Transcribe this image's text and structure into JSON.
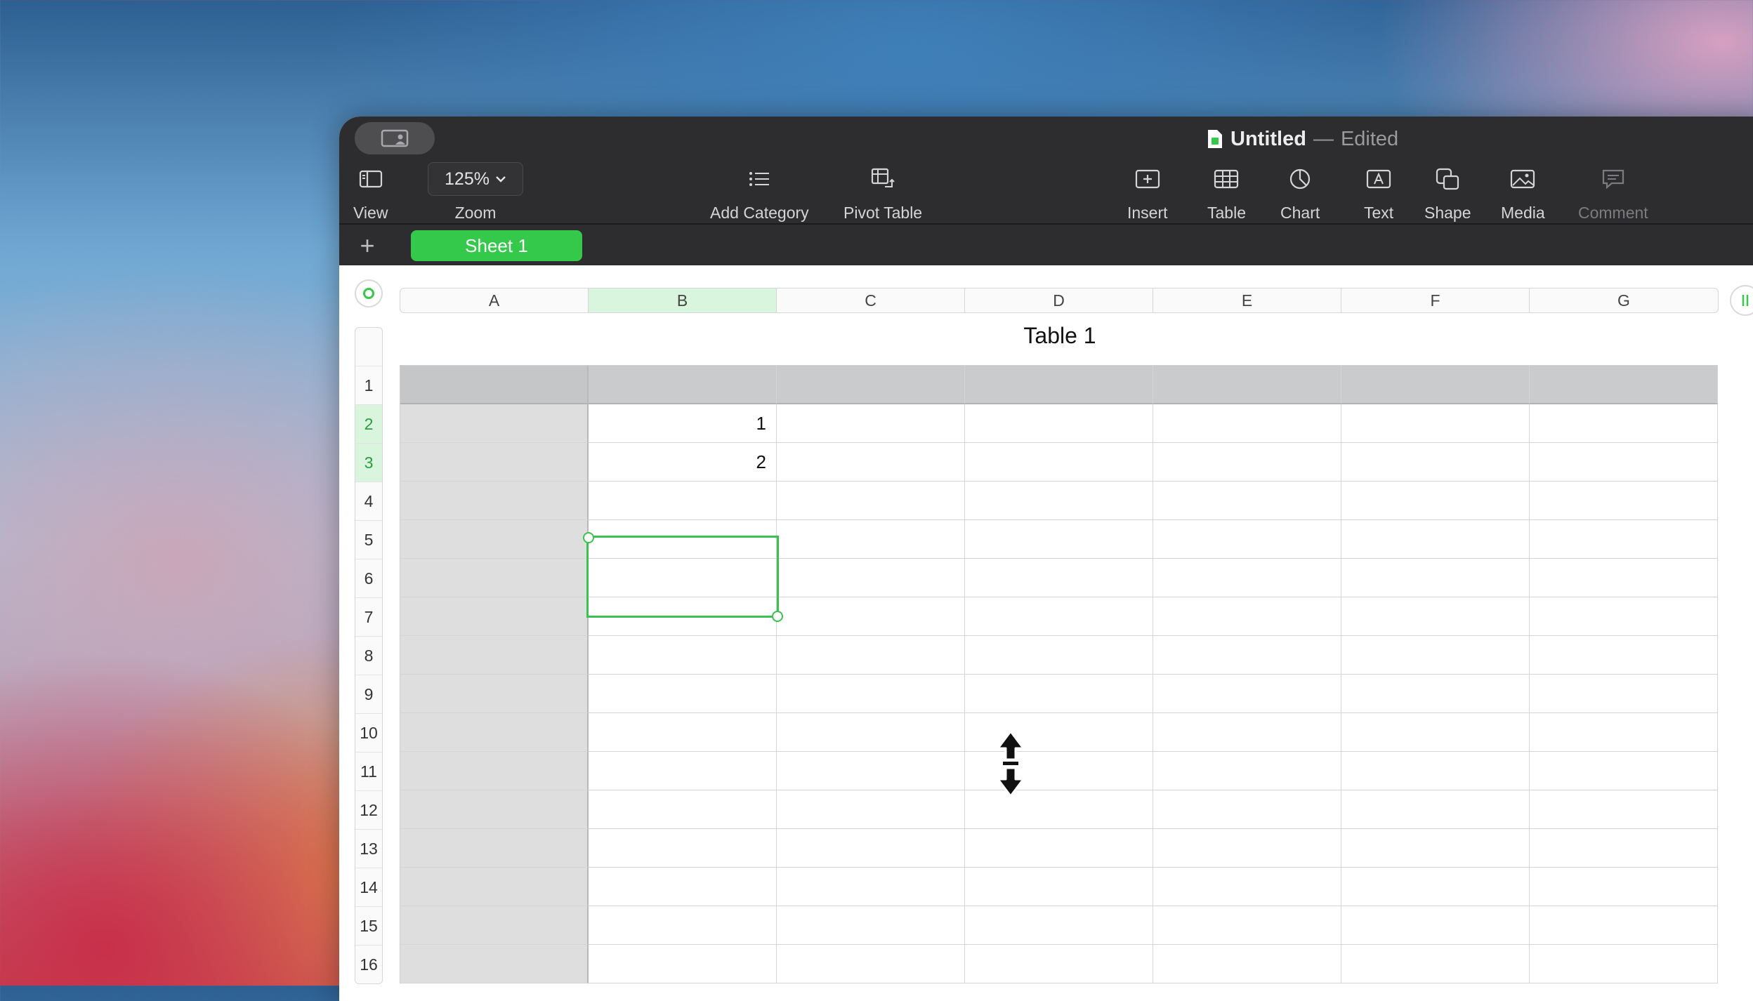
{
  "window": {
    "title": "Untitled",
    "separator": "—",
    "status": "Edited"
  },
  "toolbar": {
    "view": {
      "label": "View",
      "icon": "sidebar-icon"
    },
    "zoom": {
      "label": "Zoom",
      "value": "125%"
    },
    "add_category": {
      "label": "Add Category",
      "icon": "list-icon"
    },
    "pivot_table": {
      "label": "Pivot Table",
      "icon": "pivot-table-icon"
    },
    "insert": {
      "label": "Insert",
      "icon": "insert-icon"
    },
    "table": {
      "label": "Table",
      "icon": "table-icon"
    },
    "chart": {
      "label": "Chart",
      "icon": "chart-icon"
    },
    "text": {
      "label": "Text",
      "icon": "text-box-icon"
    },
    "shape": {
      "label": "Shape",
      "icon": "shape-icon"
    },
    "media": {
      "label": "Media",
      "icon": "media-icon"
    },
    "comment": {
      "label": "Comment",
      "icon": "comment-icon"
    }
  },
  "sheets": {
    "add_symbol": "+",
    "tabs": [
      "Sheet 1"
    ]
  },
  "table": {
    "title": "Table 1",
    "columns": [
      "A",
      "B",
      "C",
      "D",
      "E",
      "F",
      "G"
    ],
    "rows": [
      "1",
      "2",
      "3",
      "4",
      "5",
      "6",
      "7",
      "8",
      "9",
      "10",
      "11",
      "12",
      "13",
      "14",
      "15",
      "16"
    ],
    "cells": {
      "B2": "1",
      "B3": "2"
    },
    "selected_column": "B",
    "selected_rows": [
      "2",
      "3"
    ]
  },
  "colors": {
    "accent": "#36c84b",
    "toolbar_bg": "#2d2c2e",
    "selection_highlight": "#d9f5dd"
  }
}
